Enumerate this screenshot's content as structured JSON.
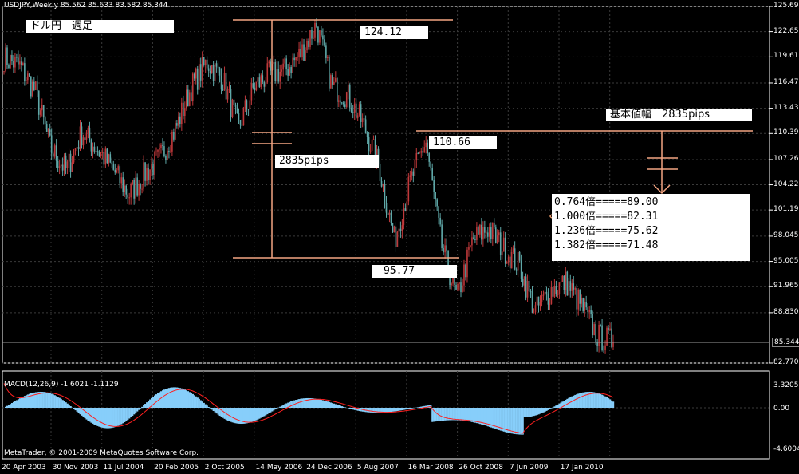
{
  "chart": {
    "symbol_header": "USDJPY,Weekly  85.562 85.633 83.582 85.344",
    "title_label": "ドル円　週足",
    "current_price": "85.344",
    "price_axis_labels": [
      "125.690",
      "122.655",
      "119.610",
      "116.475",
      "113.435",
      "110.395",
      "107.260",
      "104.225",
      "101.190",
      "98.045",
      "95.005",
      "91.965",
      "88.830",
      "85.344",
      "82.770"
    ],
    "macd_header": "MACD(12,26,9) -1.6021 -1.1129",
    "macd_axis_labels": [
      "3.3205",
      "0.00",
      "-4.6004"
    ],
    "copyright": "MetaTrader, © 2001-2009 MetaQuotes Software Corp.",
    "date_labels": [
      "20 Apr 2003",
      "30 Nov 2003",
      "11 Jul 2004",
      "20 Feb 2005",
      "2 Oct 2005",
      "14 May 2006",
      "24 Dec 2006",
      "5 Aug 2007",
      "16 Mar 2008",
      "26 Oct 2008",
      "7 Jun 2009",
      "17 Jan 2010"
    ],
    "annotations": {
      "high": "124.12",
      "low": "95.77",
      "range": "2835pips",
      "rebound_high": "110.66",
      "base_range": "基本値幅　2835pips"
    },
    "fib_targets": [
      "0.764倍=====89.00",
      "1.000倍=====82.31",
      "1.236倍=====75.62",
      "1.382倍=====71.48"
    ],
    "colors": {
      "background": "#000000",
      "bull_candle": "#c0393b",
      "bear_candle": "#5fa8a8",
      "annotation_line": "#f4a582",
      "macd_hist": "#87cefa",
      "signal_line": "#ff2020",
      "grid": "#3a3a3a"
    }
  },
  "chart_data": {
    "type": "candlestick",
    "title": "USDJPY,Weekly",
    "ylim": [
      82.77,
      125.69
    ],
    "anchor_prices": [
      [
        "2003-04",
        119.5
      ],
      [
        "2003-07",
        118.5
      ],
      [
        "2003-09",
        115.5
      ],
      [
        "2003-11",
        108.5
      ],
      [
        "2004-01",
        106.0
      ],
      [
        "2004-04",
        110.5
      ],
      [
        "2004-07",
        108.5
      ],
      [
        "2004-10",
        106.0
      ],
      [
        "2005-01",
        103.0
      ],
      [
        "2005-03",
        105.5
      ],
      [
        "2005-05",
        107.5
      ],
      [
        "2005-07",
        111.0
      ],
      [
        "2005-10",
        116.0
      ],
      [
        "2005-12",
        119.0
      ],
      [
        "2006-02",
        117.0
      ],
      [
        "2006-05",
        111.0
      ],
      [
        "2006-07",
        116.0
      ],
      [
        "2006-09",
        117.5
      ],
      [
        "2006-12",
        118.0
      ],
      [
        "2007-02",
        120.0
      ],
      [
        "2007-06",
        123.5
      ],
      [
        "2007-08",
        116.0
      ],
      [
        "2007-10",
        115.0
      ],
      [
        "2007-12",
        111.5
      ],
      [
        "2008-02",
        106.5
      ],
      [
        "2008-03",
        97.5
      ],
      [
        "2008-05",
        104.5
      ],
      [
        "2008-08",
        109.5
      ],
      [
        "2008-10",
        97.0
      ],
      [
        "2008-12",
        90.5
      ],
      [
        "2009-02",
        97.5
      ],
      [
        "2009-04",
        99.0
      ],
      [
        "2009-06",
        96.5
      ],
      [
        "2009-08",
        94.5
      ],
      [
        "2009-11",
        89.0
      ],
      [
        "2010-01",
        91.5
      ],
      [
        "2010-03",
        92.5
      ],
      [
        "2010-05",
        89.5
      ],
      [
        "2010-07",
        86.0
      ],
      [
        "2010-08",
        85.344
      ]
    ],
    "macd_ylim": [
      -4.6004,
      3.3205
    ]
  }
}
